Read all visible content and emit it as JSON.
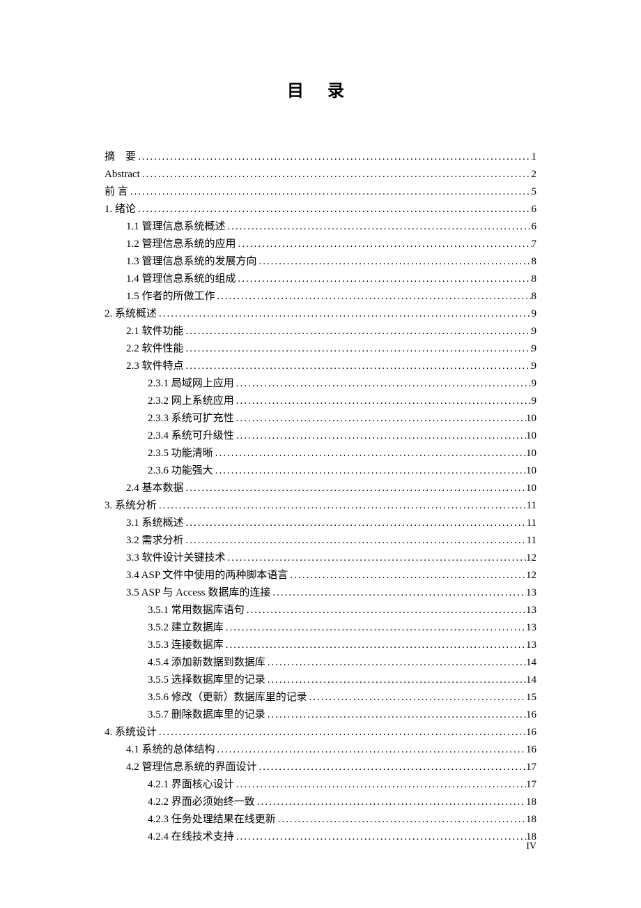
{
  "title": "目 录",
  "page_number": "IV",
  "toc": [
    {
      "level": 0,
      "label": "摘　要",
      "page": "1",
      "spaced": false
    },
    {
      "level": 0,
      "label": "Abstract",
      "page": "2",
      "spaced": false
    },
    {
      "level": 0,
      "label": "前 言",
      "page": "5",
      "spaced": false
    },
    {
      "level": 0,
      "label": "1.  绪论",
      "page": "6",
      "spaced": false
    },
    {
      "level": 1,
      "label": "1.1 管理信息系统概述",
      "page": "6",
      "spaced": false
    },
    {
      "level": 1,
      "label": "1.2 管理信息系统的应用",
      "page": "7",
      "spaced": false
    },
    {
      "level": 1,
      "label": "1.3 管理信息系统的发展方向",
      "page": "8",
      "spaced": false
    },
    {
      "level": 1,
      "label": "1.4 管理信息系统的组成",
      "page": "8",
      "spaced": false
    },
    {
      "level": 1,
      "label": "1.5 作者的所做工作",
      "page": "8",
      "spaced": false
    },
    {
      "level": 0,
      "label": "2.  系统概述",
      "page": "9",
      "spaced": false
    },
    {
      "level": 1,
      "label": "2.1 软件功能",
      "page": "9",
      "spaced": false
    },
    {
      "level": 1,
      "label": "2.2 软件性能",
      "page": "9",
      "spaced": false
    },
    {
      "level": 1,
      "label": "2.3 软件特点",
      "page": "9",
      "spaced": false
    },
    {
      "level": 2,
      "label": "2.3.1 局域网上应用",
      "page": "9",
      "spaced": false
    },
    {
      "level": 2,
      "label": "2.3.2 网上系统应用",
      "page": "9",
      "spaced": false
    },
    {
      "level": 2,
      "label": "2.3.3 系统可扩充性",
      "page": "10",
      "spaced": false
    },
    {
      "level": 2,
      "label": "2.3.4 系统可升级性",
      "page": "10",
      "spaced": false
    },
    {
      "level": 2,
      "label": "2.3.5 功能清晰",
      "page": "10",
      "spaced": false
    },
    {
      "level": 2,
      "label": "2.3.6 功能强大",
      "page": "10",
      "spaced": false
    },
    {
      "level": 1,
      "label": "2.4 基本数据",
      "page": "10",
      "spaced": false
    },
    {
      "level": 0,
      "label": "3.  系统分析",
      "page": "11",
      "spaced": false
    },
    {
      "level": 1,
      "label": "3.1 系统概述",
      "page": "11",
      "spaced": false
    },
    {
      "level": 1,
      "label": "3.2 需求分析",
      "page": "11",
      "spaced": false
    },
    {
      "level": 1,
      "label": "3.3 软件设计关键技术",
      "page": "12",
      "spaced": false
    },
    {
      "level": 1,
      "label": "3.4 ASP 文件中使用的两种脚本语言",
      "page": "12",
      "spaced": false
    },
    {
      "level": 1,
      "label": "3.5 ASP 与 Access 数据库的连接",
      "page": "13",
      "spaced": false
    },
    {
      "level": 2,
      "label": "3.5.1 常用数据库语句",
      "page": "13",
      "spaced": false
    },
    {
      "level": 2,
      "label": "3.5.2 建立数据库",
      "page": "13",
      "spaced": false
    },
    {
      "level": 2,
      "label": "3.5.3 连接数据库",
      "page": "13",
      "spaced": false
    },
    {
      "level": 2,
      "label": "4.5.4 添加新数据到数据库",
      "page": "14",
      "spaced": false
    },
    {
      "level": 2,
      "label": "3.5.5 选择数据库里的记录",
      "page": "14",
      "spaced": false
    },
    {
      "level": 2,
      "label": "3.5.6 修改（更新）数据库里的记录",
      "page": "15",
      "spaced": false
    },
    {
      "level": 2,
      "label": "3.5.7 删除数据库里的记录",
      "page": "16",
      "spaced": false
    },
    {
      "level": 0,
      "label": "4.  系统设计",
      "page": "16",
      "spaced": false
    },
    {
      "level": 1,
      "label": "4.1 系统的总体结构",
      "page": "16",
      "spaced": false
    },
    {
      "level": 1,
      "label": "4.2 管理信息系统的界面设计",
      "page": "17",
      "spaced": false
    },
    {
      "level": 2,
      "label": "4.2.1 界面核心设计",
      "page": "17",
      "spaced": false
    },
    {
      "level": 2,
      "label": "4.2.2 界面必须始终一致",
      "page": "18",
      "spaced": false
    },
    {
      "level": 2,
      "label": "4.2.3 任务处理结果在线更新",
      "page": "18",
      "spaced": false
    },
    {
      "level": 2,
      "label": "4.2.4 在线技术支持",
      "page": "18",
      "spaced": false
    }
  ]
}
